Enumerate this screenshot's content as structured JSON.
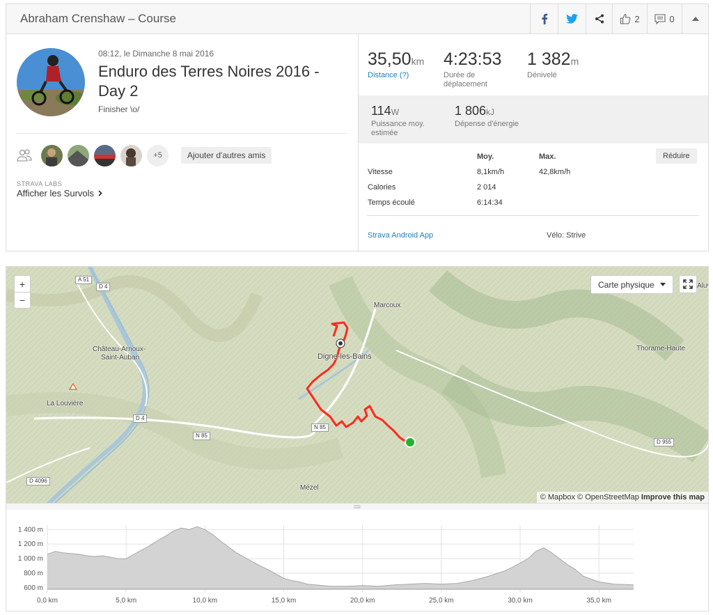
{
  "header": {
    "title": "Abraham Crenshaw – Course",
    "kudos_count": "2",
    "comment_count": "0"
  },
  "activity": {
    "date": "08:12, le Dimanche 8 mai 2016",
    "name": "Enduro des Terres Noires 2016 - Day 2",
    "description": "Finisher \\o/"
  },
  "friends": {
    "more": "+5",
    "add_button": "Ajouter d'autres amis"
  },
  "labs": {
    "tag": "STRAVA LABS",
    "flyby_link": "Afficher les Survols"
  },
  "stats": {
    "distance": {
      "value": "35,50",
      "unit": "km",
      "label": "Distance (?)"
    },
    "moving_time": {
      "value": "4:23:53",
      "label_line1": "Durée de",
      "label_line2": "déplacement"
    },
    "elevation": {
      "value": "1 382",
      "unit": "m",
      "label": "Dénivelé"
    },
    "power": {
      "value": "114",
      "unit": "W",
      "label_line1": "Puissance moy.",
      "label_line2": "estimée"
    },
    "energy": {
      "value": "1 806",
      "unit": "kJ",
      "label": "Dépense d'énergie"
    }
  },
  "table": {
    "col_avg": "Moy.",
    "col_max": "Max.",
    "reduce_button": "Réduire",
    "rows": [
      {
        "label": "Vitesse",
        "avg": "8,1km/h",
        "max": "42,8km/h"
      },
      {
        "label": "Calories",
        "avg": "2 014",
        "max": ""
      },
      {
        "label": "Temps écoulé",
        "avg": "6:14:34",
        "max": ""
      }
    ],
    "device": "Strava Android App",
    "bike": "Vélo: Strive"
  },
  "map": {
    "zoom_in": "+",
    "zoom_out": "−",
    "map_type": "Carte physique",
    "attribution_prefix": "© Mapbox © OpenStreetMap ",
    "attribution_link": "Improve this map",
    "places": {
      "marcoux": "Marcoux",
      "digne": "Digne-les-Bains",
      "chateau_line1": "Château-Arnoux-",
      "chateau_line2": "Saint-Auban",
      "louviere": "La Louvière",
      "thorame": "Thorame-Haute",
      "mezel": "Mézel",
      "partial_right": "Aluve"
    },
    "roads": {
      "a51": "A 51",
      "d4_top": "D 4",
      "d4_mid": "D 4",
      "n85_left": "N 85",
      "n85_mid": "N 85",
      "d955": "D 955",
      "d4096": "D 4096"
    }
  },
  "chart_data": {
    "type": "area",
    "title": "",
    "xlabel": "",
    "ylabel": "",
    "x_unit": "km",
    "y_unit": "m",
    "x_ticks": [
      "0,0 km",
      "5,0 km",
      "10,0 km",
      "15,0 km",
      "20,0 km",
      "25,0 km",
      "30,0 km",
      "35,0 km"
    ],
    "y_ticks": [
      "1 400 m",
      "1 200 m",
      "1 000 m",
      "800 m",
      "600 m"
    ],
    "xlim": [
      0,
      37.2
    ],
    "ylim": [
      580,
      1460
    ],
    "grid": true,
    "series": [
      {
        "x": [
          0,
          0.5,
          1,
          1.5,
          2,
          2.5,
          3,
          3.5,
          4,
          4.5,
          5,
          5.5,
          6,
          6.5,
          7,
          7.5,
          8,
          8.5,
          9,
          9.5,
          10,
          10.5,
          11,
          11.5,
          12,
          12.5,
          13,
          13.5,
          14,
          14.5,
          15,
          15.5,
          16,
          16.5,
          17,
          18,
          19,
          20,
          21,
          22,
          23,
          24,
          25,
          26,
          27,
          28,
          29,
          29.5,
          30,
          30.5,
          31,
          31.5,
          32,
          32.5,
          33,
          33.5,
          34,
          35,
          36,
          37.2
        ],
        "y": [
          1060,
          1100,
          1080,
          1070,
          1060,
          1040,
          1030,
          1040,
          1020,
          1000,
          1000,
          1060,
          1120,
          1180,
          1250,
          1310,
          1380,
          1420,
          1400,
          1440,
          1400,
          1330,
          1240,
          1160,
          1080,
          1020,
          960,
          900,
          850,
          790,
          730,
          700,
          680,
          650,
          640,
          620,
          620,
          630,
          620,
          640,
          650,
          660,
          650,
          660,
          700,
          760,
          830,
          880,
          940,
          1000,
          1100,
          1150,
          1080,
          1000,
          920,
          850,
          760,
          680,
          650,
          640
        ]
      }
    ]
  }
}
